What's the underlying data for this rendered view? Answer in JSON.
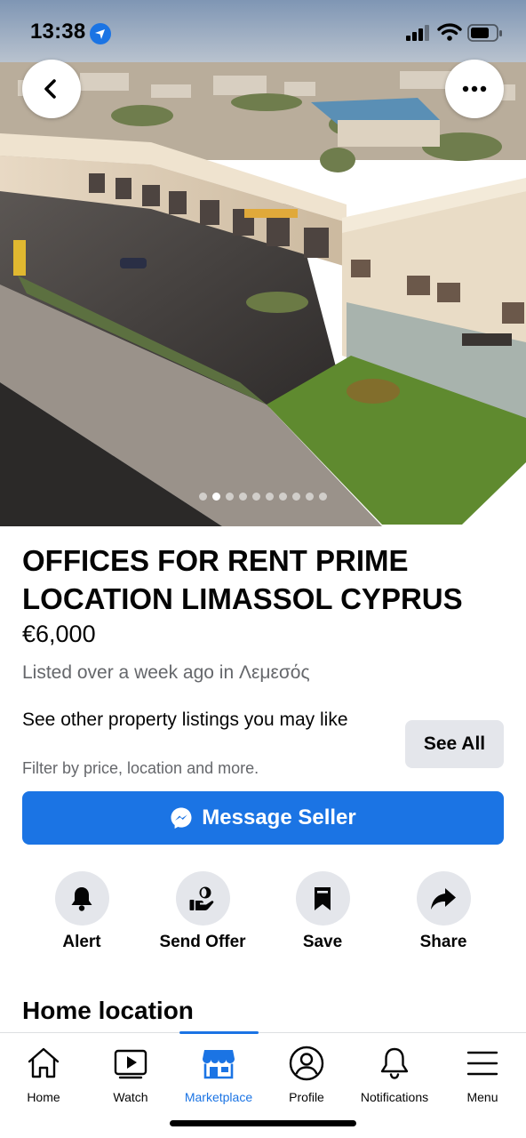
{
  "status_bar": {
    "time": "13:38",
    "icons": [
      "location-arrow-icon",
      "cellular-signal-icon",
      "wifi-icon",
      "battery-icon"
    ]
  },
  "hero": {
    "photo_description": "aerial-photo-commercial-building",
    "carousel": {
      "total": 10,
      "active_index": 1
    },
    "back_icon": "chevron-left-icon",
    "more_icon": "more-horizontal-icon"
  },
  "listing": {
    "title": "OFFICES FOR RENT PRIME LOCATION LIMASSOL CYPRUS",
    "price": "€6,000",
    "listed_text": "Listed over a week ago in Λεμεσός"
  },
  "promo": {
    "title": "See other property listings you may like",
    "subtitle": "Filter by price, location and more.",
    "button_label": "See All"
  },
  "message_button": {
    "label": "Message Seller",
    "icon": "messenger-icon"
  },
  "actions": [
    {
      "label": "Alert",
      "icon": "bell-icon"
    },
    {
      "label": "Send Offer",
      "icon": "send-offer-icon"
    },
    {
      "label": "Save",
      "icon": "bookmark-icon"
    },
    {
      "label": "Share",
      "icon": "share-arrow-icon"
    }
  ],
  "section": {
    "title": "Home location"
  },
  "tabbar": {
    "active": "Marketplace",
    "tabs": [
      {
        "label": "Home",
        "icon": "home-icon"
      },
      {
        "label": "Watch",
        "icon": "watch-icon"
      },
      {
        "label": "Marketplace",
        "icon": "marketplace-icon"
      },
      {
        "label": "Profile",
        "icon": "profile-icon"
      },
      {
        "label": "Notifications",
        "icon": "notifications-icon"
      },
      {
        "label": "Menu",
        "icon": "menu-icon"
      }
    ]
  },
  "colors": {
    "accent": "#1b74e4",
    "text_primary": "#050505",
    "text_secondary": "#65676b",
    "button_gray": "#e4e6eb"
  }
}
